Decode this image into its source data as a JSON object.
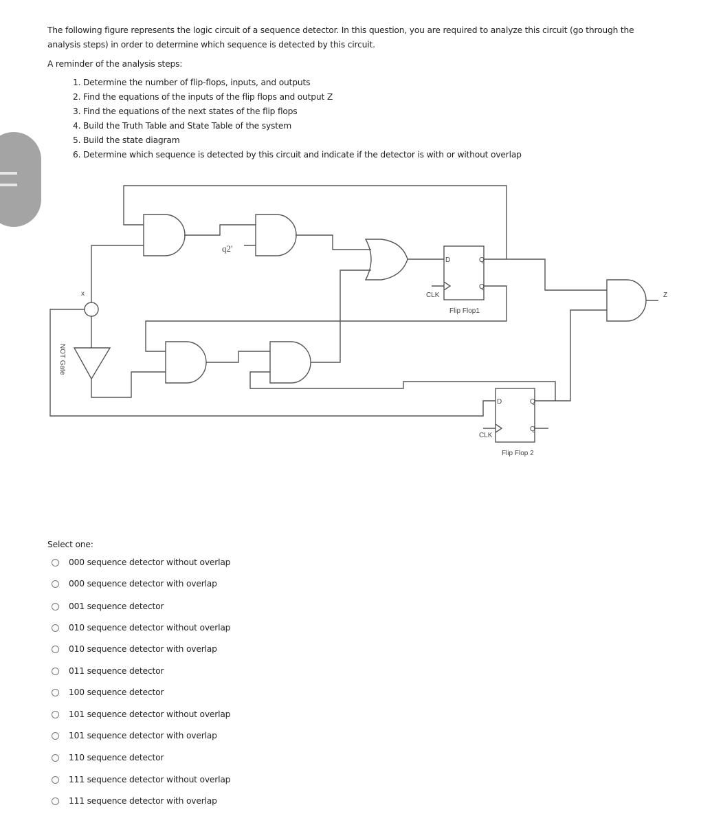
{
  "question": {
    "intro": "The following figure represents the logic circuit of a sequence detector. In this question, you are required to analyze this circuit (go through the analysis steps) in order to determine which sequence is detected by this circuit.",
    "reminder_title": "A reminder of the analysis steps:",
    "steps": [
      "1. Determine the number of flip-flops, inputs, and outputs",
      "2. Find the equations of the inputs of the flip flops and output Z",
      "3. Find the equations of the next states of the flip flops",
      "4. Build the Truth Table and State Table of the system",
      "5. Build the state diagram",
      "6. Determine which sequence is detected by this circuit and indicate if the detector is with or without overlap"
    ]
  },
  "circuit": {
    "input_label": "x",
    "not_gate_label": "NOT Gate",
    "q2_not_label": "q2'",
    "output_label": "Z",
    "ff1": {
      "d": "D",
      "q": "Q",
      "qn": "Q",
      "clk": "CLK",
      "name": "Flip Flop1"
    },
    "ff2": {
      "d": "D",
      "q": "Q",
      "qn": "Q",
      "clk": "CLK",
      "name": "Flip Flop 2"
    }
  },
  "answers": {
    "prompt": "Select one:",
    "options": [
      "000 sequence detector without overlap",
      "000 sequence detector with overlap",
      "001 sequence detector",
      "010 sequence detector without overlap",
      "010 sequence detector with overlap",
      "011 sequence detector",
      "100 sequence detector",
      "101 sequence detector without overlap",
      "101 sequence detector with overlap",
      "110 sequence detector",
      "111 sequence detector without overlap",
      "111 sequence detector with overlap"
    ]
  }
}
